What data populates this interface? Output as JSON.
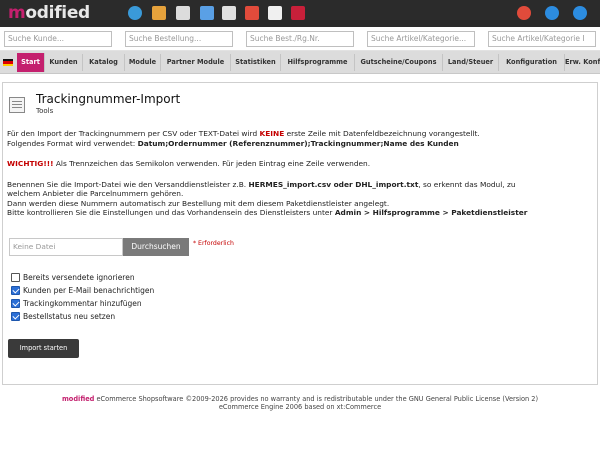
{
  "brand": {
    "logo_prefix": "m",
    "logo_rest": "odified",
    "accent": "#c4206e"
  },
  "toolbar_icons": [
    {
      "name": "globe-icon",
      "color": "#3a9ad9"
    },
    {
      "name": "users-icon",
      "color": "#e6a23c"
    },
    {
      "name": "order-icon",
      "color": "#dcdcdc"
    },
    {
      "name": "copy-icon",
      "color": "#5aa0e6"
    },
    {
      "name": "document-icon",
      "color": "#e0e0e0"
    },
    {
      "name": "shield-icon",
      "color": "#e14b3b"
    },
    {
      "name": "mail-icon",
      "color": "#f0f0f0"
    },
    {
      "name": "cube-icon",
      "color": "#c8203a"
    }
  ],
  "right_icons": [
    {
      "name": "help-ring-icon",
      "color": "#e14b3b"
    },
    {
      "name": "refresh-icon",
      "color": "#2c8ce0"
    },
    {
      "name": "info-icon",
      "color": "#2c8ce0"
    }
  ],
  "search": {
    "customer_placeholder": "Suche Kunde...",
    "order_placeholder": "Suche Bestellung...",
    "order_no_placeholder": "Suche Best./Rg.Nr.",
    "article_placeholder": "Suche Artikel/Kategorie...",
    "article2_placeholder": "Suche Artikel/Kategorie I"
  },
  "nav": {
    "items": [
      "Start",
      "Kunden",
      "Katalog",
      "Module",
      "Partner Module",
      "Statistiken",
      "Hilfsprogramme",
      "Gutscheine/Coupons",
      "Land/Steuer",
      "Konfiguration",
      "Erw. Konf"
    ]
  },
  "page": {
    "title": "Trackingnummer-Import",
    "subtitle": "Tools",
    "intro_1a": "Für den Import der Trackingnummern per CSV oder TEXT-Datei wird ",
    "intro_1b": "KEINE",
    "intro_1c": " erste Zeile mit Datenfeldbezeichnung vorangestellt.",
    "intro_2a": "Folgendes Format wird verwendet: ",
    "intro_2b": "Datum;Ordernummer (Referenznummer);Trackingnummer;Name des Kunden",
    "warning_label": "WICHTIG!!!",
    "warning_text": " Als Trennzeichen das Semikolon verwenden. Für jeden Eintrag eine Zeile verwenden.",
    "naming_1a": "Benennen Sie die Import-Datei wie den Versanddienstleister z.B. ",
    "naming_1b": "HERMES_import.csv oder DHL_import.txt",
    "naming_1c": ", so erkennt das Modul, zu",
    "naming_2": "welchem Anbieter die Parcelnummern gehören.",
    "naming_3": "Dann werden diese Nummern automatisch zur Bestellung mit dem diesem Paketdienstleister angelegt.",
    "naming_4a": "Bitte kontrollieren Sie die Einstellungen und das Vorhandensein des Dienstleisters unter ",
    "naming_4b": "Admin > Hilfsprogramme > Paketdienstleister"
  },
  "form": {
    "file_placeholder": "Keine Datei",
    "browse_label": "Durchsuchen",
    "required_note": "* Erforderlich",
    "checkboxes": [
      {
        "label": "Bereits versendete ignorieren",
        "checked": false
      },
      {
        "label": "Kunden per E-Mail benachrichtigen",
        "checked": true
      },
      {
        "label": "Trackingkommentar hinzufügen",
        "checked": true
      },
      {
        "label": "Bestellstatus neu setzen",
        "checked": true
      }
    ],
    "submit_label": "Import starten"
  },
  "footer": {
    "brand": "modified",
    "line1": " eCommerce Shopsoftware ©2009-2026 provides no warranty and is redistributable under the GNU General Public License (Version 2)",
    "line2": "eCommerce Engine 2006 based on xt:Commerce"
  }
}
